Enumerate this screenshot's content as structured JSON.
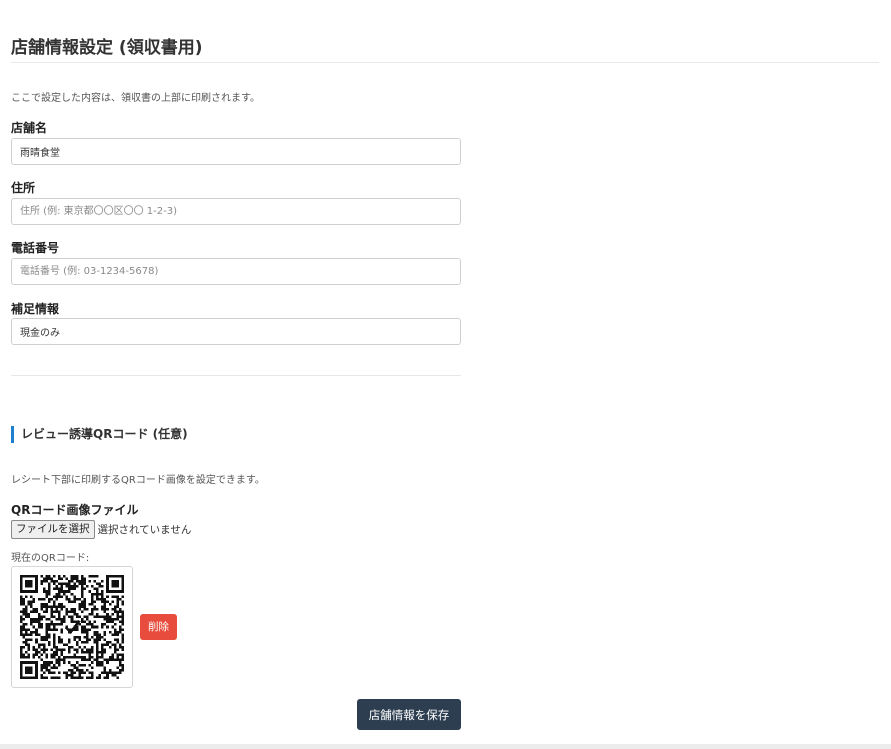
{
  "page": {
    "title": "店舗情報設定 (領収書用)",
    "description": "ここで設定した内容は、領収書の上部に印刷されます。"
  },
  "fields": {
    "store_name": {
      "label": "店舗名",
      "value": "雨晴食堂",
      "placeholder": ""
    },
    "address": {
      "label": "住所",
      "value": "",
      "placeholder": "住所 (例: 東京都〇〇区〇〇 1-2-3)"
    },
    "phone": {
      "label": "電話番号",
      "value": "",
      "placeholder": "電話番号 (例: 03-1234-5678)"
    },
    "notes": {
      "label": "補足情報",
      "value": "現金のみ",
      "placeholder": ""
    }
  },
  "qr_section": {
    "heading": "レビュー誘導QRコード (任意)",
    "description": "レシート下部に印刷するQRコード画像を設定できます。",
    "file_label": "QRコード画像ファイル",
    "file_button_label": "ファイルを選択",
    "file_status": "選択されていません",
    "current_label": "現在のQRコード:",
    "delete_label": "削除"
  },
  "save_label": "店舗情報を保存",
  "colors": {
    "accent": "#1e7fd0",
    "delete": "#e74c3c",
    "save": "#2c3e50"
  }
}
